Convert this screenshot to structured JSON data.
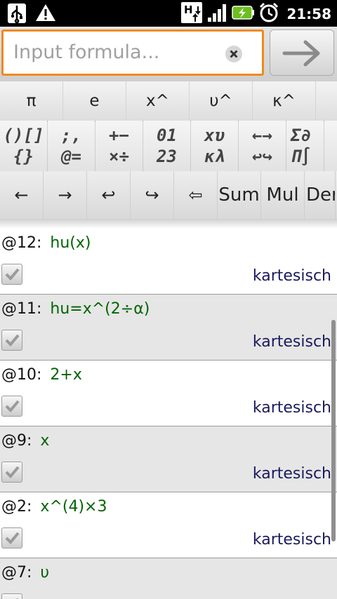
{
  "status_bar": {
    "time": "21:58",
    "icons": [
      "usb-icon",
      "warning-icon",
      "network-h-icon",
      "signal-icon",
      "battery-charging-icon",
      "alarm-icon"
    ]
  },
  "input": {
    "placeholder": "Input formula..."
  },
  "symbols": [
    "π",
    "e",
    "x^",
    "υ^",
    "κ^"
  ],
  "keyboard_groups": [
    {
      "line1": "()[]",
      "line2": "{}"
    },
    {
      "line1": ";,",
      "line2": "@="
    },
    {
      "line1": "+−",
      "line2": "×÷"
    },
    {
      "line1": "01",
      "line2": "23"
    },
    {
      "line1": "xυ",
      "line2": "κλ"
    },
    {
      "line1": "←→",
      "line2": "↩↪"
    },
    {
      "line1": "Σ∂",
      "line2": "Π∫"
    }
  ],
  "nav_buttons": [
    "←",
    "→",
    "↩",
    "↪",
    "⇦",
    "Sum",
    "Mul",
    "Der"
  ],
  "formulas": [
    {
      "id": "@12:",
      "formula": "hu(x)",
      "mode": "kartesisch",
      "checked": true
    },
    {
      "id": "@11:",
      "formula": "hu=x^(2÷α)",
      "mode": "kartesisch",
      "checked": true
    },
    {
      "id": "@10:",
      "formula": "2+x",
      "mode": "kartesisch",
      "checked": true
    },
    {
      "id": "@9:",
      "formula": "x",
      "mode": "kartesisch",
      "checked": true
    },
    {
      "id": "@2:",
      "formula": "x^(4)×3",
      "mode": "kartesisch",
      "checked": true
    },
    {
      "id": "@7:",
      "formula": "υ",
      "mode": "",
      "checked": true
    }
  ],
  "colors": {
    "accent_focus": "#f08a1e",
    "formula_text": "#006400",
    "mode_text": "#1a1a5e"
  }
}
